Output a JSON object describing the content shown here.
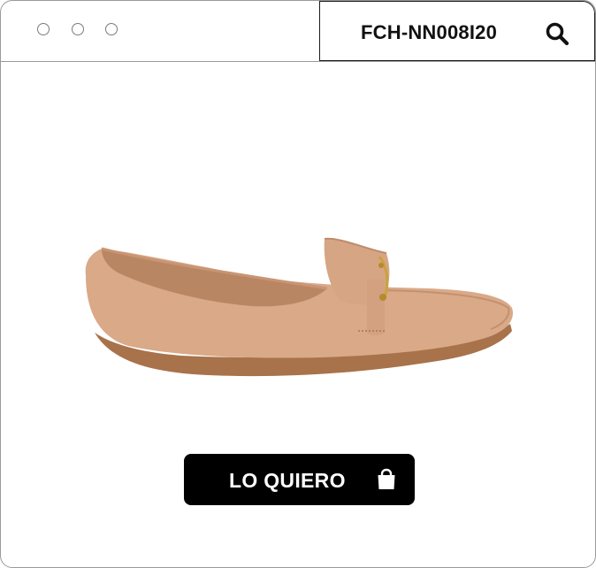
{
  "window": {
    "controls": [
      "window-dot",
      "window-dot",
      "window-dot"
    ]
  },
  "search": {
    "value": "FCH-NN008I20",
    "icon": "search-icon"
  },
  "product": {
    "image": "beige-loafer-shoe",
    "colors": {
      "upper": "#D9A988",
      "sole": "#A8724A"
    }
  },
  "cta": {
    "label": "LO QUIERO",
    "icon": "shopping-bag-icon",
    "background": "#000000"
  }
}
